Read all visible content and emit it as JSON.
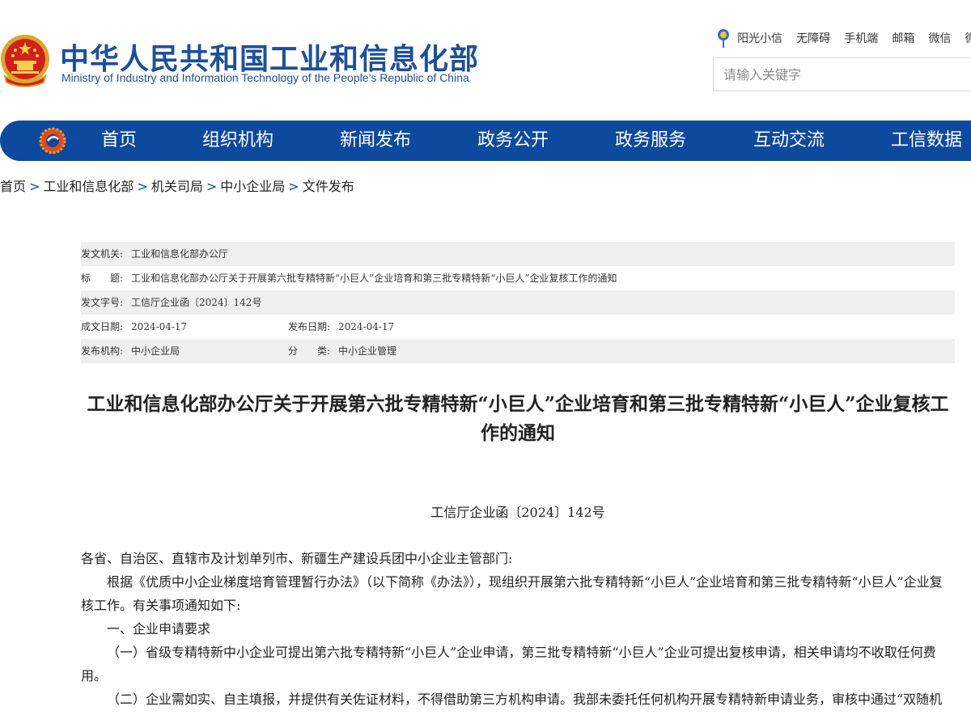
{
  "header": {
    "title_cn": "中华人民共和国工业和信息化部",
    "title_en": "Ministry of Industry and Information Technology of the People’s Republic of China",
    "top_links": [
      "阳光小信",
      "无障碍",
      "手机端",
      "邮箱",
      "微信",
      "微博"
    ],
    "search_placeholder": "请输入关键字"
  },
  "nav": {
    "items": [
      "首页",
      "组织机构",
      "新闻发布",
      "政务公开",
      "政务服务",
      "互动交流",
      "工信数据"
    ]
  },
  "breadcrumb": [
    "首页",
    "工业和信息化部",
    "机关司局",
    "中小企业局",
    "文件发布"
  ],
  "meta": {
    "issuer_label": "发文机关:",
    "issuer": "工业和信息化部办公厅",
    "title_label": "标　　题:",
    "title": "工业和信息化部办公厅关于开展第六批专精特新“小巨人”企业培育和第三批专精特新“小巨人”企业复核工作的通知",
    "doc_no_label": "发文字号:",
    "doc_no": "工信厅企业函〔2024〕142号",
    "written_label": "成文日期:",
    "written": "2024-04-17",
    "published_label": "发布日期:",
    "published": "2024-04-17",
    "agency_label": "发布机构:",
    "agency": "中小企业局",
    "category_label": "分　　类:",
    "category": "中小企业管理"
  },
  "document": {
    "title": "工业和信息化部办公厅关于开展第六批专精特新“小巨人”企业培育和第三批专精特新“小巨人”企业复核工作的通知",
    "number": "工信厅企业函〔2024〕142号",
    "salutation": "各省、自治区、直辖市及计划单列市、新疆生产建设兵团中小企业主管部门:",
    "para1": "根据《优质中小企业梯度培育管理暂行办法》（以下简称《办法》），现组织开展第六批专精特新“小巨人”企业培育和第三批专精特新“小巨人”企业复核工作。有关事项通知如下:",
    "section1": "一、企业申请要求",
    "item1": "（一）省级专精特新中小企业可提出第六批专精特新“小巨人”企业申请，第三批专精特新“小巨人”企业可提出复核申请，相关申请均不收取任何费用。",
    "item2": "（二）企业需如实、自主填报，并提供有关佐证材料，不得借助第三方机构申请。我部未委托任何机构开展专精特新申请业务，审核中通过“双随机"
  },
  "colors": {
    "brand_blue": "#0d4a9e",
    "meta_shade": "#efefef"
  }
}
